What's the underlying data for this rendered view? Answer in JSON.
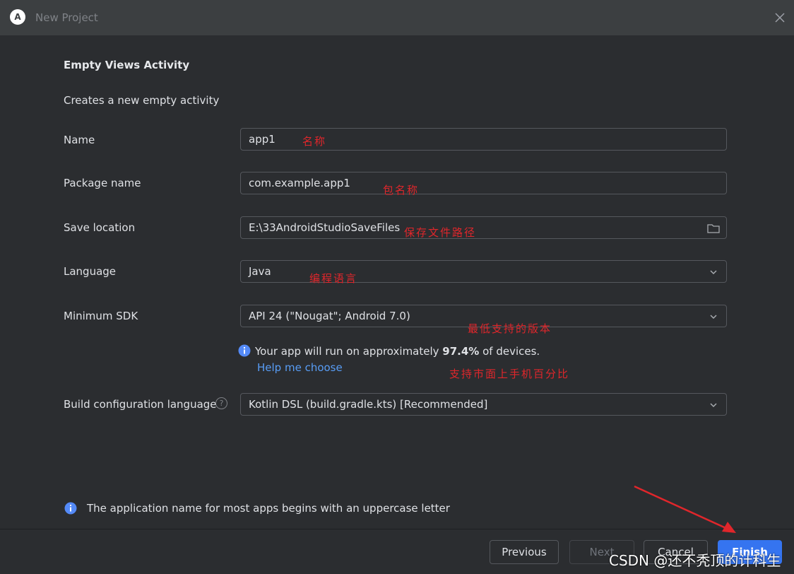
{
  "window": {
    "title": "New Project"
  },
  "template": {
    "heading": "Empty Views Activity",
    "description": "Creates a new empty activity"
  },
  "fields": {
    "name": {
      "label": "Name",
      "value": "app1"
    },
    "package": {
      "label": "Package name",
      "value": "com.example.app1"
    },
    "save_location": {
      "label": "Save location",
      "value": "E:\\33AndroidStudioSaveFiles"
    },
    "language": {
      "label": "Language",
      "value": "Java"
    },
    "min_sdk": {
      "label": "Minimum SDK",
      "value": "API 24 (\"Nougat\"; Android 7.0)"
    },
    "build_config": {
      "label": "Build configuration language",
      "value": "Kotlin DSL (build.gradle.kts) [Recommended]"
    }
  },
  "sdk_info": {
    "prefix": "Your app will run on approximately ",
    "percent": "97.4%",
    "suffix": " of devices.",
    "help_link": "Help me choose"
  },
  "footer_hint": "The application name for most apps begins with an uppercase letter",
  "buttons": {
    "previous": "Previous",
    "next": "Next",
    "cancel": "Cancel",
    "finish": "Finish"
  },
  "annotations": {
    "name": "名称",
    "package": "包名称",
    "save_location": "保存文件路径",
    "language": "编程语言",
    "min_sdk": "最低支持的版本",
    "coverage": "支持市面上手机百分比"
  },
  "watermark": "CSDN @还不秃顶的计科生",
  "icons": {
    "window": "android-studio-icon",
    "close": "close-icon",
    "folder": "folder-icon",
    "dropdown": "chevron-down-icon",
    "info": "info-icon",
    "help": "question-icon"
  },
  "colors": {
    "background": "#2b2d30",
    "accent": "#3574f0",
    "link": "#589df6",
    "annotation": "#e0262b"
  }
}
